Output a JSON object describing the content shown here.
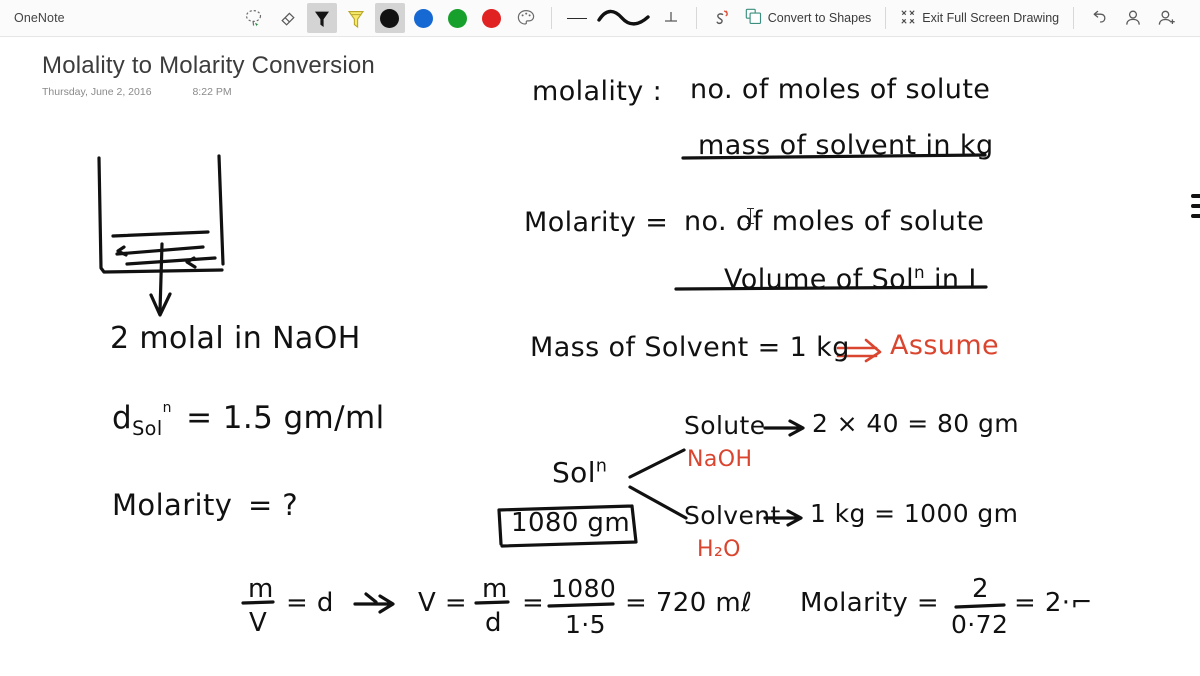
{
  "app": {
    "name": "OneNote"
  },
  "toolbar": {
    "tools": [
      {
        "name": "lasso-select-icon",
        "label": "Lasso Select",
        "selected": false
      },
      {
        "name": "eraser-icon",
        "label": "Eraser",
        "selected": false
      },
      {
        "name": "pen-icon",
        "label": "Pen",
        "selected": true
      },
      {
        "name": "highlighter-icon",
        "label": "Highlighter",
        "selected": false
      }
    ],
    "colors": [
      {
        "name": "color-swatch-black",
        "label": "Black",
        "hex": "#121212",
        "selected": true
      },
      {
        "name": "color-swatch-blue",
        "label": "Blue",
        "hex": "#1668d2",
        "selected": false
      },
      {
        "name": "color-swatch-green",
        "label": "Green",
        "hex": "#17a02b",
        "selected": false
      },
      {
        "name": "color-swatch-red",
        "label": "Red",
        "hex": "#e02222",
        "selected": false
      }
    ],
    "palette_label": "Color & Thickness",
    "thickness": [
      {
        "name": "thin-stroke-icon",
        "label": "Thin"
      },
      {
        "name": "thick-stroke-icon",
        "label": "Thick",
        "selected": true
      },
      {
        "name": "ruler-icon",
        "label": "Ruler"
      }
    ],
    "ink_replay_label": "Ink Replay",
    "convert_to_shapes_label": "Convert to Shapes",
    "exit_full_screen_label": "Exit Full Screen Drawing",
    "undo_label": "Undo",
    "account_label": "Account",
    "share_label": "Share"
  },
  "page": {
    "title": "Molality to Molarity Conversion",
    "date": "Thursday, June 2, 2016",
    "time": "8:22 PM"
  },
  "ink": {
    "left_column": {
      "given_molal": "2 molal in NaOH",
      "density_symbol": "d",
      "density_sub": "Sol",
      "density_sub_sup": "n",
      "density_value": "= 1.5 gm/ml",
      "question_label": "Molarity",
      "question_mark": "= ?"
    },
    "formula_molality": {
      "lhs": "molality :",
      "numerator": "no. of moles of solute",
      "denominator": "mass of solvent  in kg"
    },
    "formula_molarity": {
      "lhs": "Molarity =",
      "numerator": "no. of moles of solute",
      "denominator_pre": "Volume  of Sol",
      "denominator_sup": "n",
      "denominator_post": " in L"
    },
    "assumption": {
      "text": "Mass of Solvent = 1 kg",
      "arrow": "⇒",
      "note": "Assume"
    },
    "breakdown": {
      "root_label": "Sol",
      "root_sup": "n",
      "boxed_total": "1080 gm",
      "solute_label": "Solute",
      "solute_arrow": "→",
      "solute_calc": "2 × 40 = 80  gm",
      "solute_formula": "NaOH",
      "solvent_label": "Solvent",
      "solvent_arrow": "→",
      "solvent_calc": "1 kg  = 1000 gm",
      "solvent_formula": "H₂O"
    },
    "volume_work": {
      "dens_num": "m",
      "dens_den": "V",
      "dens_eq": "= d",
      "arrow": "⇒",
      "v_label": "V =",
      "v_num": "m",
      "v_den": "d",
      "eq1": "=",
      "frac_num": "1080",
      "frac_den": "1·5",
      "result": "= 720 mℓ"
    },
    "final_answer": {
      "label": "Molarity =",
      "num": "2",
      "den": "0·72",
      "result": "= 2·⌐"
    }
  }
}
